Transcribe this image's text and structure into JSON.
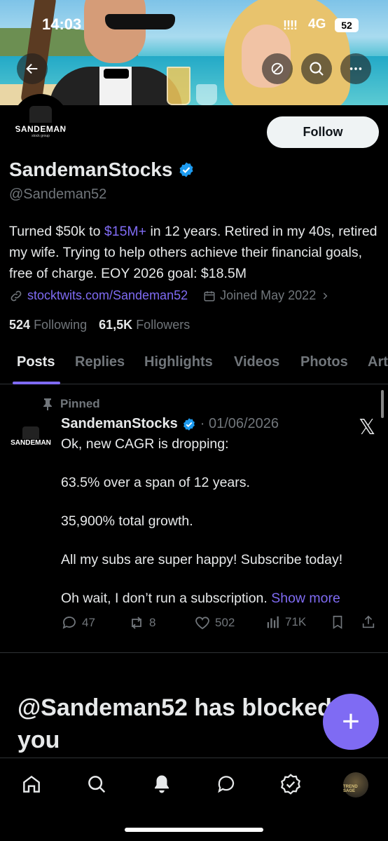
{
  "status": {
    "time": "14:03",
    "signal": "!!!!",
    "network": "4G",
    "battery": "52"
  },
  "profile": {
    "avatar_text": "SANDEMAN",
    "avatar_subtext": "stock group",
    "name": "SandemanStocks",
    "handle": "@Sandeman52",
    "bio_part1": "Turned $50k to ",
    "bio_link": "$15M+",
    "bio_part2": " in 12 years. Retired in my 40s, retired my wife. Trying to help others achieve their financial goals, free of charge. EOY 2026 goal: $18.5M",
    "website": "stocktwits.com/Sandeman52",
    "joined": "Joined May 2022",
    "following_count": "524",
    "following_label": "Following",
    "followers_count": "61,5K",
    "followers_label": "Followers",
    "follow_label": "Follow"
  },
  "tabs": [
    "Posts",
    "Replies",
    "Highlights",
    "Videos",
    "Photos",
    "Art"
  ],
  "post": {
    "pinned_label": "Pinned",
    "author": "SandemanStocks",
    "date": "· 01/06/2026",
    "lines": [
      "Ok, new CAGR is dropping:",
      "63.5% over a span of 12 years.",
      "35,900% total growth.",
      "All my subs are super happy!  Subscribe today!",
      "Oh wait, I don’t run a subscription. "
    ],
    "show_more": "Show more",
    "replies": "47",
    "reposts": "8",
    "likes": "502",
    "views": "71K",
    "x_logo": "𝕏"
  },
  "blocked_message": "@Sandeman52 has blocked you",
  "fab_label": "+",
  "nav_avatar_text": "TREND SAGE",
  "colors": {
    "accent": "#7f6bf3",
    "verified": "#1d9bf0",
    "muted": "#71767b"
  }
}
